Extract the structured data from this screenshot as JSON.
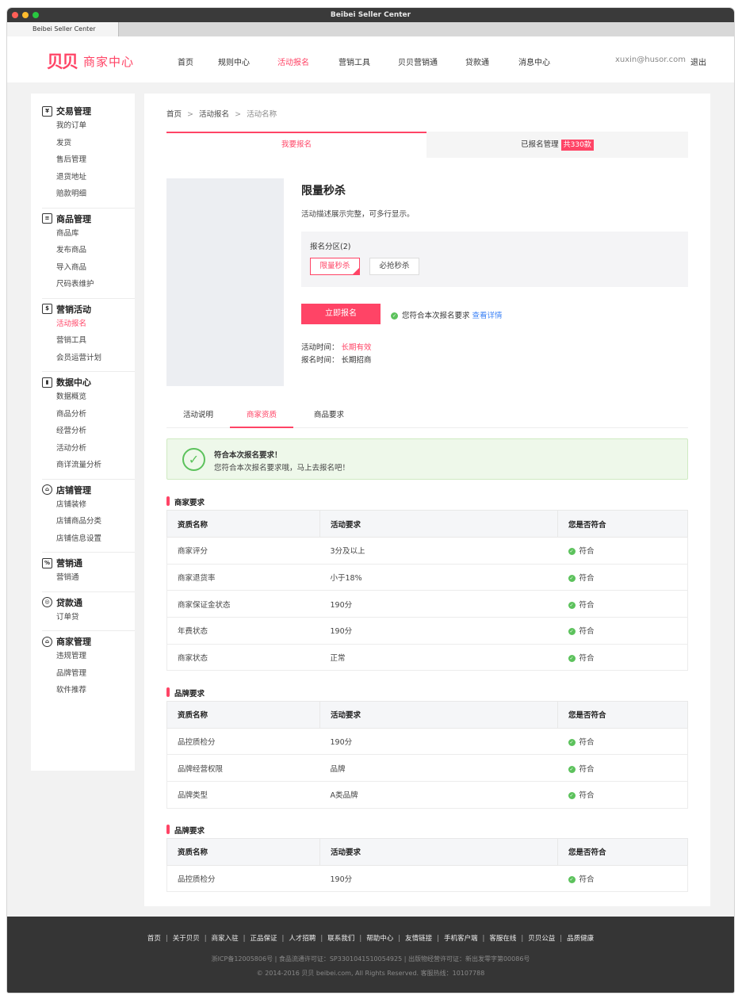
{
  "window": {
    "title": "Beibei Seller Center",
    "tab_label": "Beibei Seller Center"
  },
  "colors": {
    "accent": "#ff4466",
    "success": "#5cc25c",
    "link": "#3b82f6",
    "footer_bg": "#353535"
  },
  "header": {
    "logo_mark": "贝贝",
    "logo_text": "商家中心",
    "nav": [
      "首页",
      "规则中心",
      "活动报名",
      "营销工具",
      "贝贝营销通",
      "贷款通",
      "消息中心"
    ],
    "nav_active": "活动报名",
    "user_email": "xuxin@husor.com",
    "logout": "退出"
  },
  "sidebar": [
    {
      "title": "交易管理",
      "icon": "receipt-icon",
      "items": [
        "我的订单",
        "发货",
        "售后管理",
        "退货地址",
        "赔款明细"
      ]
    },
    {
      "title": "商品管理",
      "icon": "clipboard-icon",
      "items": [
        "商品库",
        "发布商品",
        "导入商品",
        "尺码表维护"
      ]
    },
    {
      "title": "营销活动",
      "icon": "money-bag-icon",
      "items": [
        "活动报名",
        "营销工具",
        "会员运营计划"
      ]
    },
    {
      "title": "数据中心",
      "icon": "bar-chart-icon",
      "items": [
        "数据概览",
        "商品分析",
        "经营分析",
        "活动分析",
        "商详流量分析"
      ]
    },
    {
      "title": "店铺管理",
      "icon": "shop-icon",
      "items": [
        "店铺装修",
        "店铺商品分类",
        "店铺信息设置"
      ]
    },
    {
      "title": "营销通",
      "icon": "percent-icon",
      "items": [
        "营销通"
      ]
    },
    {
      "title": "贷款通",
      "icon": "coin-icon",
      "items": [
        "订单贷"
      ]
    },
    {
      "title": "商家管理",
      "icon": "store-icon",
      "items": [
        "违规管理",
        "品牌管理",
        "软件推荐"
      ]
    }
  ],
  "sidebar_active": "活动报名",
  "breadcrumb": {
    "home": "首页",
    "sep": ">",
    "level2": "活动报名",
    "current": "活动名称"
  },
  "top_tabs": {
    "signup": "我要报名",
    "managed": "已报名管理",
    "managed_badge": "共330款"
  },
  "activity": {
    "title": "限量秒杀",
    "desc": "活动描述展示完整，可多行显示。",
    "zone_title": "报名分区(2)",
    "zones": [
      "限量秒杀",
      "必抢秒杀"
    ],
    "signup_button": "立即报名",
    "eligible_text": "您符合本次报名要求",
    "details_link": "查看详情",
    "activity_time_label": "活动时间：",
    "activity_time_value": "长期有效",
    "signup_time_label": "报名时间：",
    "signup_time_value": "长期招商"
  },
  "sub_tabs": [
    "活动说明",
    "商家资质",
    "商品要求"
  ],
  "sub_tab_active": "商家资质",
  "notice": {
    "title": "符合本次报名要求！",
    "text": "您符合本次报名要求哦，马上去报名吧！"
  },
  "table_headers": [
    "资质名称",
    "活动要求",
    "您是否符合"
  ],
  "sections": [
    {
      "title": "商家要求",
      "rows": [
        [
          "商家评分",
          "3分及以上",
          "符合"
        ],
        [
          "商家退货率",
          "小于18%",
          "符合"
        ],
        [
          "商家保证金状态",
          "190分",
          "符合"
        ],
        [
          "年费状态",
          "190分",
          "符合"
        ],
        [
          "商家状态",
          "正常",
          "符合"
        ]
      ]
    },
    {
      "title": "品牌要求",
      "rows": [
        [
          "品控质检分",
          "190分",
          "符合"
        ],
        [
          "品牌经营权限",
          "品牌",
          "符合"
        ],
        [
          "品牌类型",
          "A类品牌",
          "符合"
        ]
      ]
    },
    {
      "title": "品牌要求",
      "rows": [
        [
          "品控质检分",
          "190分",
          "符合"
        ]
      ]
    }
  ],
  "footer": {
    "links": [
      "首页",
      "关于贝贝",
      "商家入驻",
      "正品保证",
      "人才招聘",
      "联系我们",
      "帮助中心",
      "友情链接",
      "手机客户端",
      "客服在线",
      "贝贝公益",
      "品质健康"
    ],
    "license": "浙ICP备12005806号 | 食品流通许可证：SP3301041510054925 | 出版物经营许可证：新出发零字第00086号",
    "copyright": "© 2014-2016 贝贝 beibei.com,  All Rights Reserved. 客服热线：10107788"
  }
}
